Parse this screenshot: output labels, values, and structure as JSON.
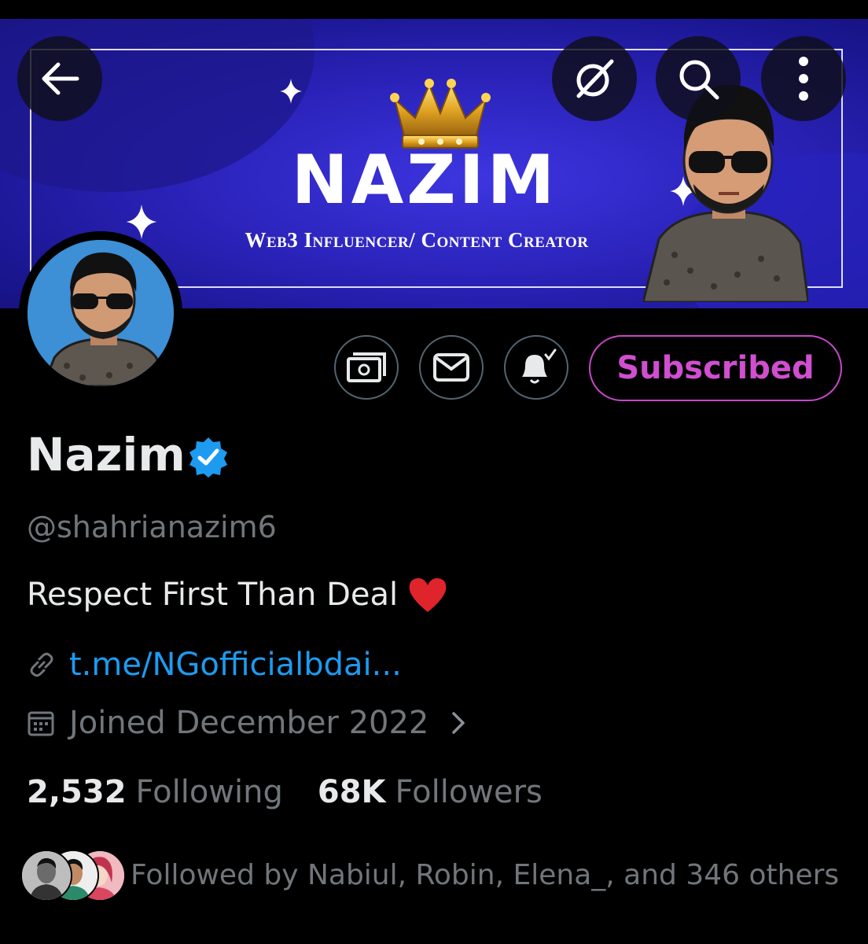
{
  "banner": {
    "title": "NAZIM",
    "subtitle": "Web3 Influencer/ Content Creator"
  },
  "nav": {
    "back_icon": "arrow-left-icon",
    "grok_icon": "grok-icon",
    "search_icon": "search-icon",
    "more_icon": "more-vertical-icon"
  },
  "actions": {
    "tip_icon": "money-icon",
    "message_icon": "mail-icon",
    "notify_icon": "bell-check-icon",
    "subscribe_label": "Subscribed",
    "subscribe_color": "#d04ed0"
  },
  "profile": {
    "name": "Nazim",
    "handle": "@shahrianazim6",
    "bio": "Respect First Than Deal",
    "link": "t.me/NGofficialbdai...",
    "joined": "Joined December 2022",
    "following_count": "2,532",
    "following_label": "Following",
    "followers_count": "68K",
    "followers_label": "Followers",
    "followed_by": "Followed by Nabiul, Robin, Elena_, and 346 others"
  },
  "colors": {
    "background": "#000000",
    "link": "#1d9bf0",
    "muted": "#71767b",
    "verified": "#1d9bf0"
  }
}
